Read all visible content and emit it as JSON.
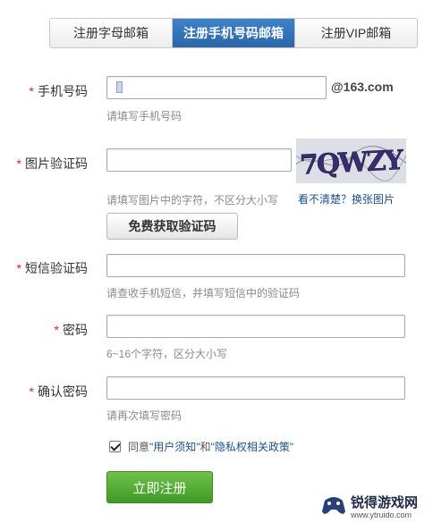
{
  "tabs": [
    {
      "label": "注册字母邮箱",
      "active": false
    },
    {
      "label": "注册手机号码邮箱",
      "active": true
    },
    {
      "label": "注册VIP邮箱",
      "active": false
    }
  ],
  "form": {
    "required_mark": "*",
    "phone": {
      "label": "手机号码",
      "domain_suffix": "@163.com",
      "hint": "请填写手机号码",
      "value": ""
    },
    "image_code": {
      "label": "图片验证码",
      "hint": "请填写图片中的字符，不区分大小写",
      "value": "",
      "captcha_text": "7QWZY",
      "unclear_text": "看不清楚？",
      "change_link": "换张图片"
    },
    "get_code_button": "免费获取验证码",
    "sms_code": {
      "label": "短信验证码",
      "hint": "请查收手机短信，并填写短信中的验证码",
      "value": ""
    },
    "password": {
      "label": "密码",
      "hint": "6~16个字符，区分大小写",
      "value": ""
    },
    "confirm_password": {
      "label": "确认密码",
      "hint": "请再次填写密码",
      "value": ""
    },
    "agreement": {
      "checked": true,
      "prefix": "同意",
      "terms_link": "\"用户须知\"",
      "and_text": "和",
      "privacy_link": "\"隐私权相关政策\""
    },
    "submit_button": "立即注册"
  },
  "watermark": {
    "name": "锐得游戏网",
    "url": "www.ytruido.com"
  },
  "colors": {
    "accent_blue": "#2a66a8",
    "required_red": "#d5262b",
    "submit_green": "#3e9a25",
    "link_blue": "#1d4e89"
  }
}
